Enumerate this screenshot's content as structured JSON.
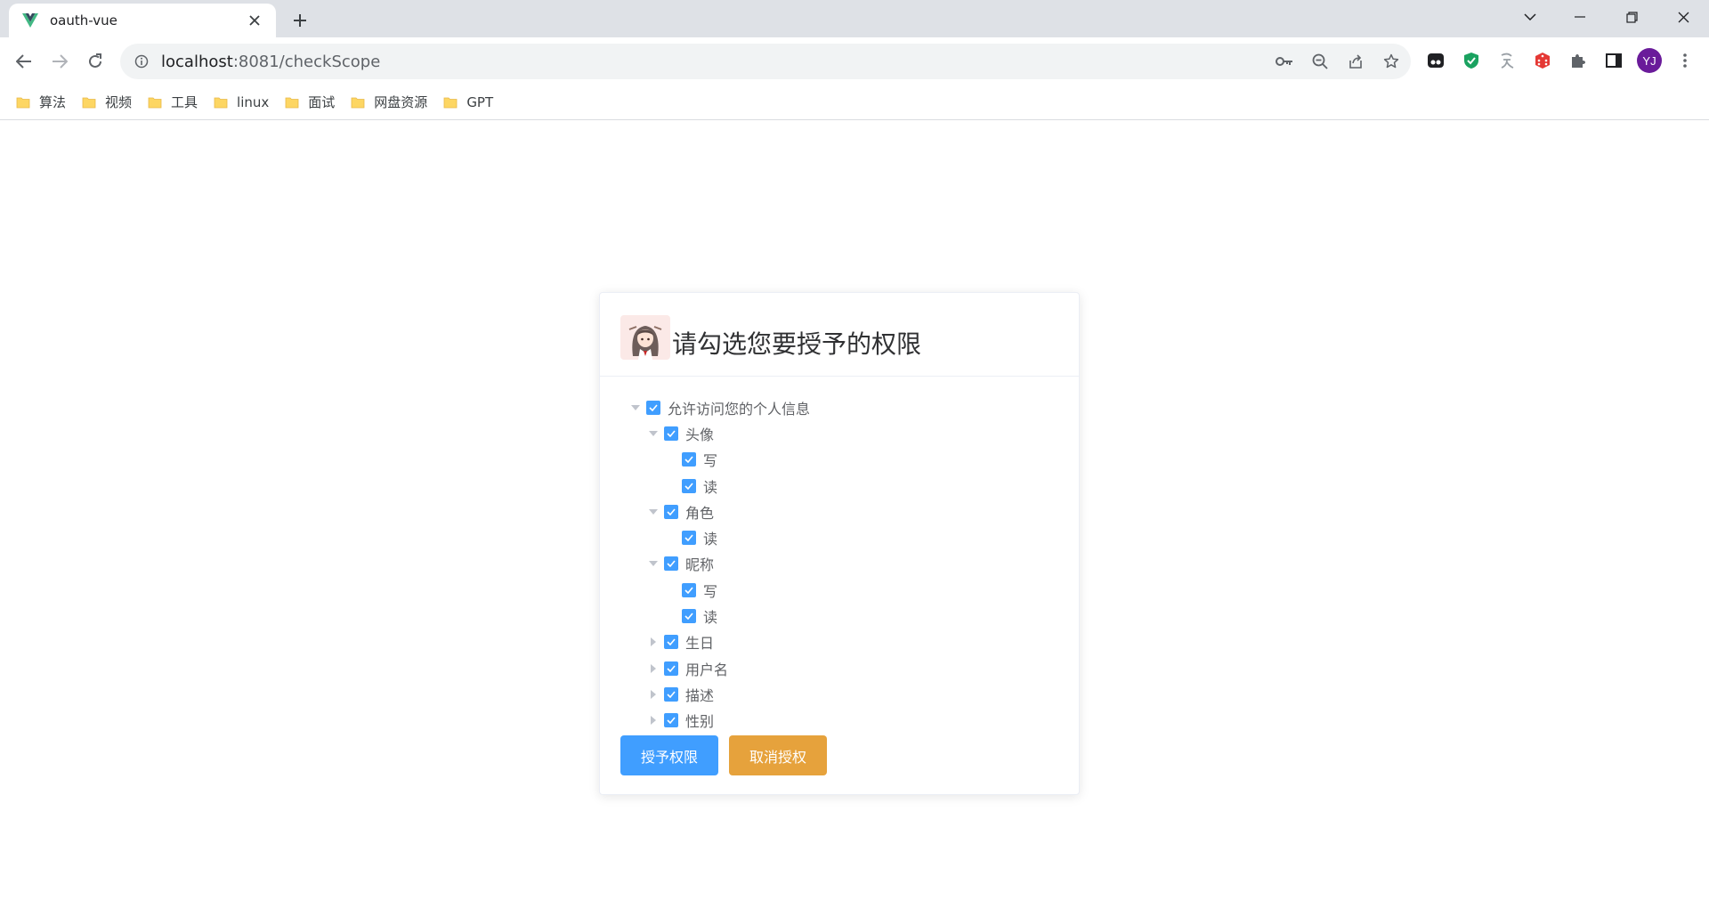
{
  "browser": {
    "tab": {
      "title": "oauth-vue",
      "favicon": "vue-logo-icon",
      "accent": "#41b883"
    },
    "url": {
      "host": "localhost",
      "rest": ":8081/checkScope"
    },
    "profile_initials": "YJ"
  },
  "bookmarks": [
    {
      "label": "算法"
    },
    {
      "label": "视频"
    },
    {
      "label": "工具"
    },
    {
      "label": "linux"
    },
    {
      "label": "面试"
    },
    {
      "label": "网盘资源"
    },
    {
      "label": "GPT"
    }
  ],
  "card": {
    "title": "请勾选您要授予的权限",
    "tree": {
      "root": {
        "label": "允许访问您的个人信息",
        "checked": true,
        "expanded": true
      },
      "avatar": {
        "label": "头像",
        "checked": true,
        "expanded": true,
        "write": "写",
        "read": "读"
      },
      "role": {
        "label": "角色",
        "checked": true,
        "expanded": true,
        "read": "读"
      },
      "nickname": {
        "label": "昵称",
        "checked": true,
        "expanded": true,
        "write": "写",
        "read": "读"
      },
      "birthday": {
        "label": "生日",
        "checked": true,
        "expanded": false
      },
      "username": {
        "label": "用户名",
        "checked": true,
        "expanded": false
      },
      "description": {
        "label": "描述",
        "checked": true,
        "expanded": false
      },
      "gender": {
        "label": "性别",
        "checked": true,
        "expanded": false
      }
    },
    "grant_button": "授予权限",
    "cancel_button": "取消授权"
  },
  "colors": {
    "primary": "#409eff",
    "warning": "#e6a23c",
    "avatar_bg": "#6a1b9a"
  }
}
